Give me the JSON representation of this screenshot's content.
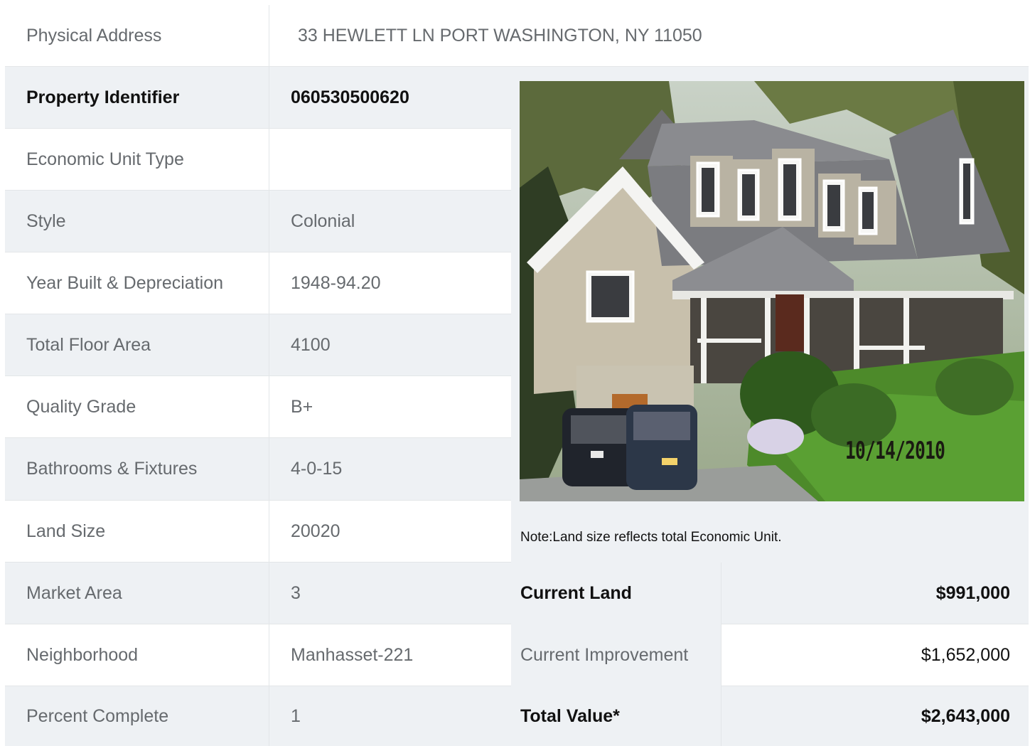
{
  "address": {
    "label": "Physical Address",
    "value": "33  HEWLETT LN  PORT WASHINGTON, NY  11050"
  },
  "details": [
    {
      "label": "Property Identifier",
      "value": "060530500620"
    },
    {
      "label": "Economic Unit Type",
      "value": ""
    },
    {
      "label": "Style",
      "value": "Colonial"
    },
    {
      "label": "Year Built & Depreciation",
      "value": "1948-94.20"
    },
    {
      "label": "Total Floor Area",
      "value": "4100"
    },
    {
      "label": "Quality Grade",
      "value": "B+"
    },
    {
      "label": "Bathrooms & Fixtures",
      "value": "4-0-15"
    },
    {
      "label": "Land Size",
      "value": "20020"
    },
    {
      "label": "Market Area",
      "value": "3"
    },
    {
      "label": "Neighborhood",
      "value": "Manhasset-221"
    },
    {
      "label": "Percent Complete",
      "value": "1"
    }
  ],
  "photo": {
    "date_stamp": "10/14/2010"
  },
  "note": "Note:Land size reflects total Economic Unit.",
  "valuation": [
    {
      "label": "Current Land",
      "value": "$991,000"
    },
    {
      "label": "Current Improvement",
      "value": "$1,652,000"
    },
    {
      "label": "Total Value*",
      "value": "$2,643,000"
    }
  ],
  "colors": {
    "row_alt": "#eef1f4",
    "border": "#e3e6e8",
    "text_muted": "#666a6e",
    "text_strong": "#111111"
  }
}
